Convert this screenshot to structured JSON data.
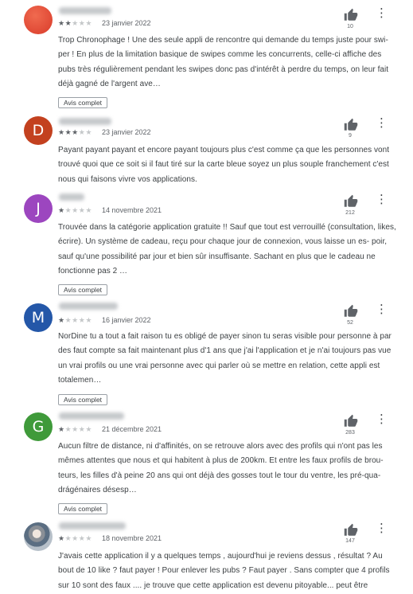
{
  "reviews": [
    {
      "initial": "",
      "avatar_color": "#d93b2a",
      "rating": 2,
      "date": "23 janvier 2022",
      "likes": "10",
      "text": "Trop Chronophage ! Une des seule appli de rencontre qui demande du temps juste pour swi- per ! En plus de la limitation basique de swipes comme les concurrents, celle-ci affiche des pubs très régulièrement pendant les swipes donc pas d'intérêt à perdre du temps, on leur fait déjà gagné de l'argent ave…",
      "button": "Avis complet"
    },
    {
      "initial": "D",
      "avatar_color": "#c3411f",
      "rating": 3,
      "date": "23 janvier 2022",
      "likes": "9",
      "text": "Payant payant payant et encore payant toujours plus c'est comme ça que les personnes vont trouvé quoi que ce soit si il faut tiré sur la carte bleue soyez un plus souple franchement c'est nous qui faisons vivre vos applications.",
      "button": ""
    },
    {
      "initial": "J",
      "avatar_color": "#9c46bf",
      "rating": 1,
      "date": "14 novembre 2021",
      "likes": "212",
      "text": "Trouvée dans la catégorie application gratuite !! Sauf que tout est verrouillé (consultation, likes, écrire). Un système de cadeau, reçu pour chaque jour de connexion, vous laisse un es- poir, sauf qu'une possibilité par jour et bien sûr insuffisante. Sachant en plus que le cadeau ne fonctionne pas 2 …",
      "button": "Avis complet"
    },
    {
      "initial": "M",
      "avatar_color": "#2457a8",
      "rating": 1,
      "date": "16 janvier 2022",
      "likes": "52",
      "text": "NorDine tu a tout a fait raison tu es obligé de payer sinon tu seras visible pour personne à par des faut compte sa fait maintenant plus d'1 ans que j'ai l'application et je n'ai toujours pas vue un vrai profils ou une vrai personne avec qui parler où se mettre en relation, cette appli est totalemen…",
      "button": "Avis complet"
    },
    {
      "initial": "G",
      "avatar_color": "#3f9a3a",
      "rating": 1,
      "date": "21 décembre 2021",
      "likes": "283",
      "text": "Aucun filtre de distance, ni d'affinités, on se retrouve alors avec des profils qui n'ont pas les mêmes attentes que nous et qui habitent à plus de 200km. Et entre les faux profils de brou- teurs, les filles d'à peine 20 ans qui ont déjà des gosses tout le tour du ventre, les pré-qua- drágénaires désesp…",
      "button": "Avis complet"
    },
    {
      "initial": "",
      "avatar_color": "#7d8691",
      "rating": 1,
      "date": "18 novembre 2021",
      "likes": "147",
      "text": "J'avais cette application il y a quelques temps , aujourd'hui je reviens dessus , résultat ? Au bout de 10 like ? faut payer ! Pour enlever les pubs ? Faut payer . Sans compter que 4 profils sur 10 sont des faux .... je trouve que cette application est devenu pitoyable... peut être",
      "button": ""
    }
  ]
}
